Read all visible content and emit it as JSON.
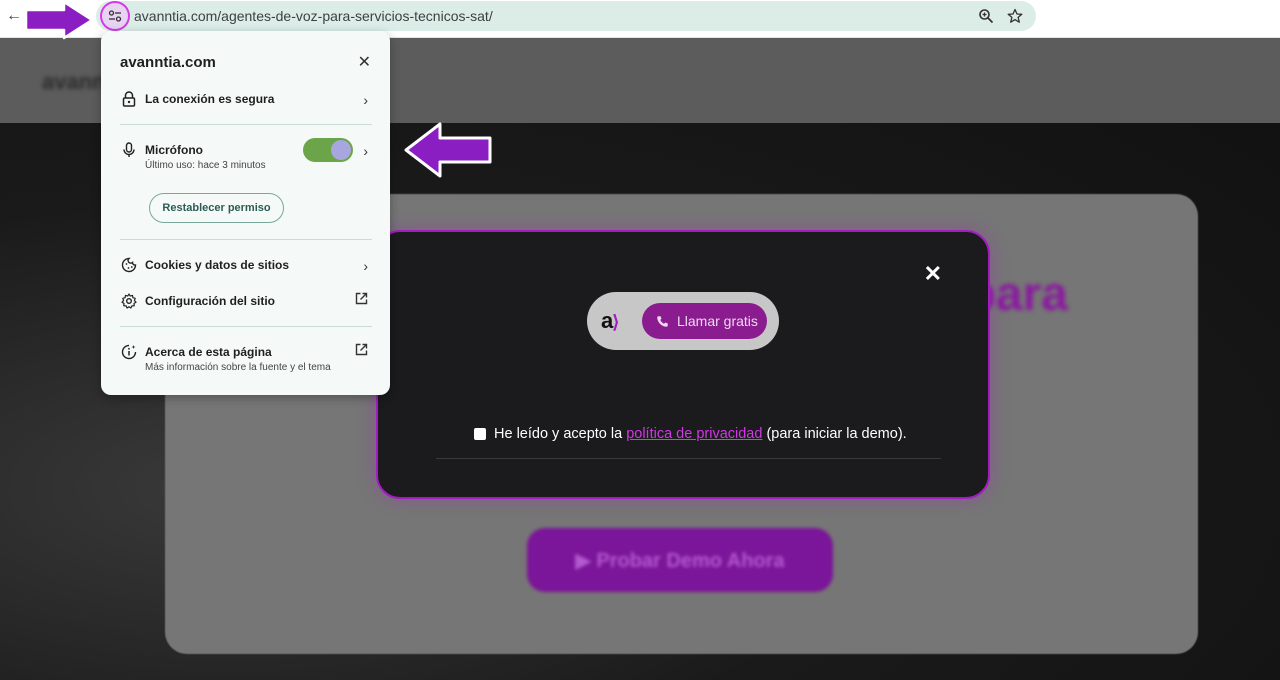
{
  "browser": {
    "url": "avanntia.com/agentes-de-voz-para-servicios-tecnicos-sat/"
  },
  "site_info": {
    "domain": "avanntia.com",
    "connection_label": "La conexión es segura",
    "microphone": {
      "label": "Micrófono",
      "last_used": "Último uso: hace 3 minutos",
      "enabled": true,
      "reset_label": "Restablecer permiso"
    },
    "cookies_label": "Cookies y datos de sitios",
    "site_settings_label": "Configuración del sitio",
    "about": {
      "label": "Acerca de esta página",
      "description": "Más información sobre la fuente y el tema"
    }
  },
  "modal": {
    "call_label": "Llamar gratis",
    "consent_prefix": "He leído y acepto la ",
    "privacy_link": "política de privacidad",
    "consent_suffix": " (para iniciar la demo)."
  },
  "background": {
    "heading_fragment": "para",
    "cta_label": "▶ Probar Demo Ahora"
  },
  "colors": {
    "accent": "#a21cc0",
    "toggle_on": "#6ca44a",
    "omnibox": "#dcede8"
  }
}
